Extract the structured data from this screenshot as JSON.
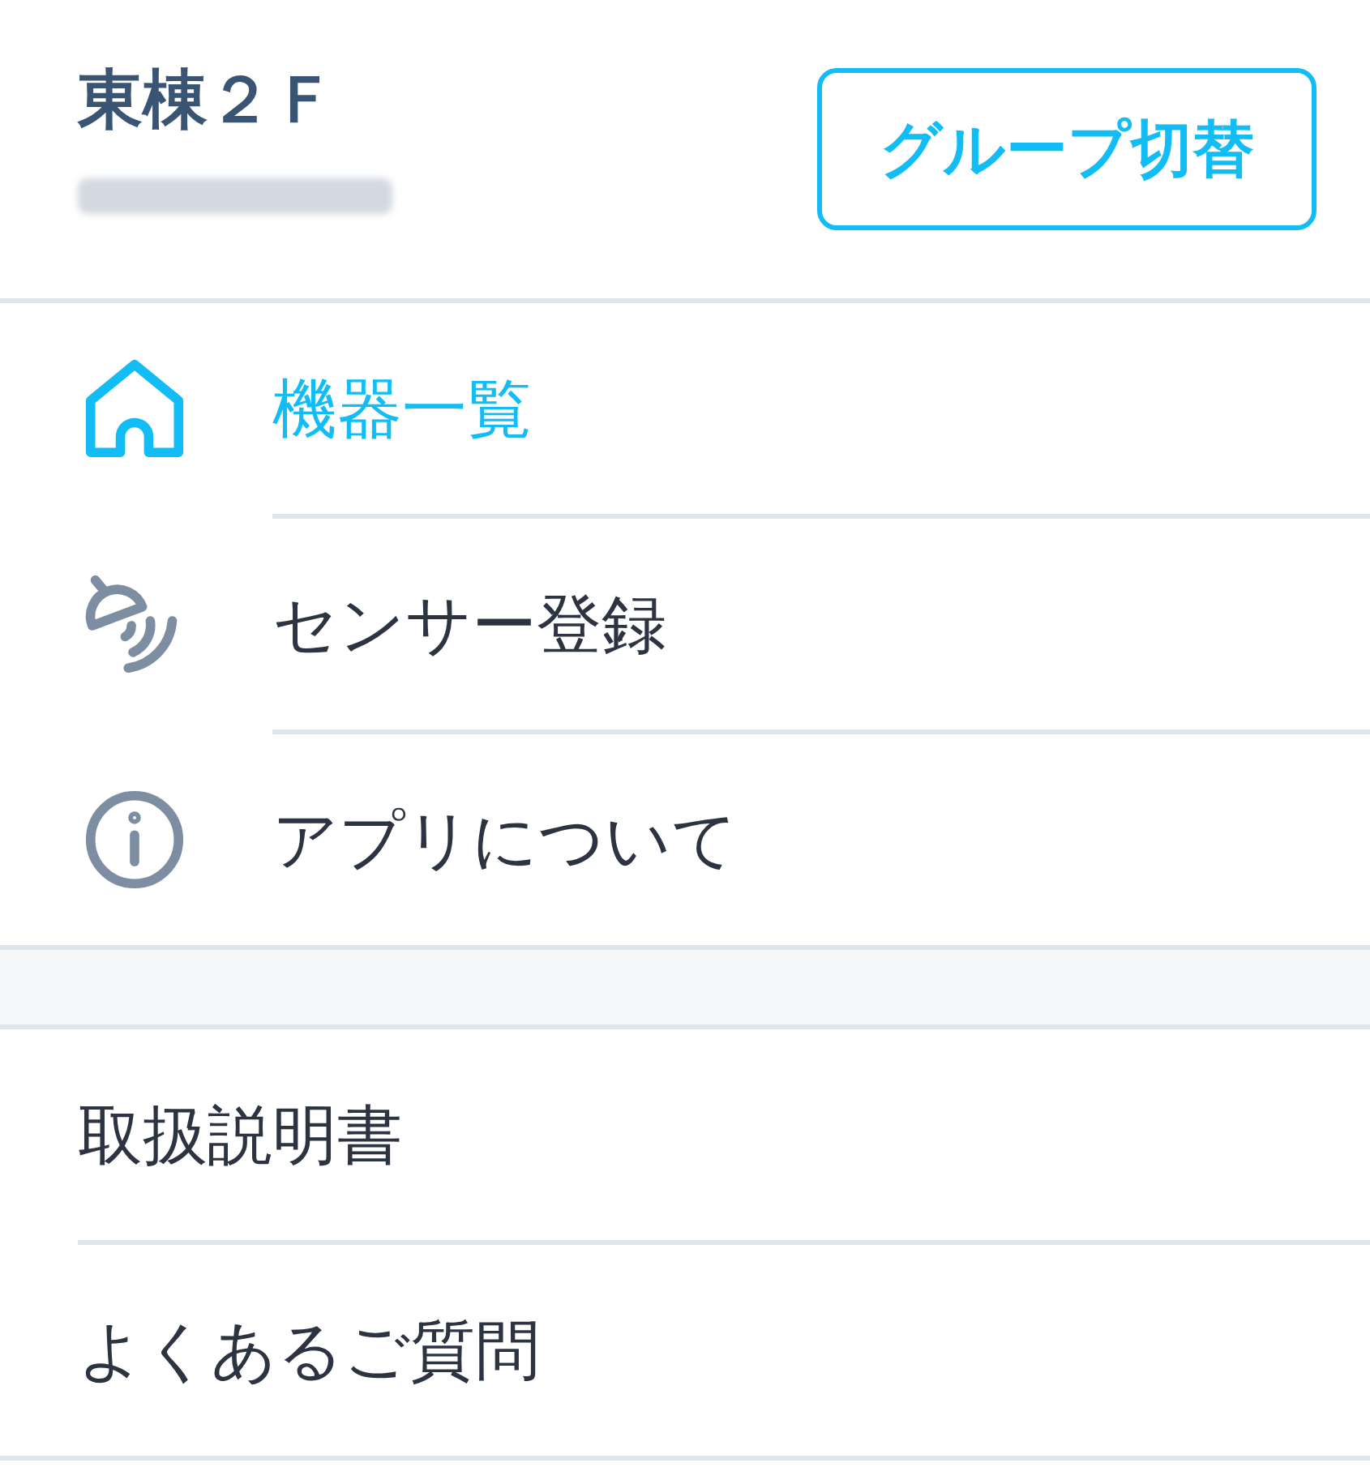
{
  "header": {
    "title": "東棟２Ｆ",
    "username_redacted": true,
    "button": "グループ切替"
  },
  "nav_items": [
    {
      "label": "機器一覧",
      "selected": true
    },
    {
      "label": "センサー登録",
      "selected": false
    },
    {
      "label": "アプリについて",
      "selected": false
    }
  ],
  "help_items": [
    {
      "label": "取扱説明書"
    },
    {
      "label": "よくあるご質問"
    }
  ]
}
